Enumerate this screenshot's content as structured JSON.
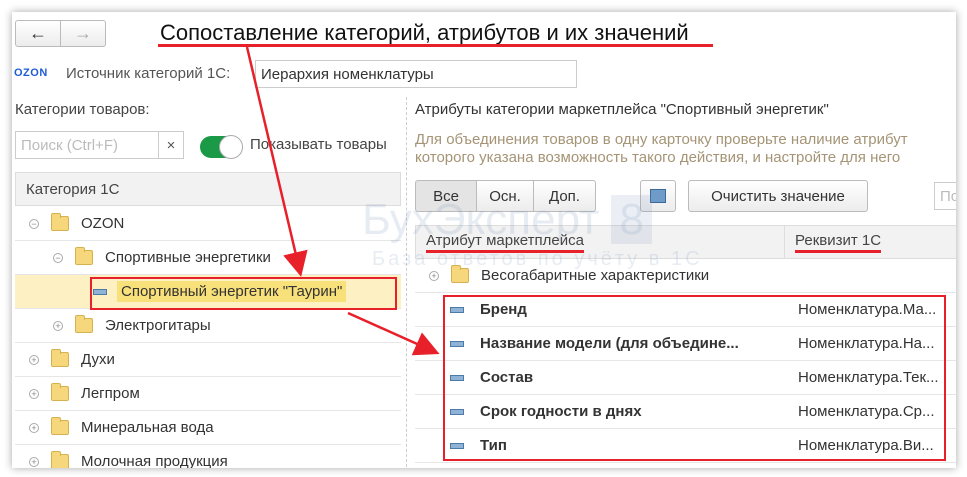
{
  "annotation_title": "Сопоставление категорий, атрибутов и их значений",
  "nav": {
    "back": "←",
    "forward": "→"
  },
  "source": {
    "logo": "OZON",
    "label": "Источник категорий 1С:",
    "value": "Иерархия номенклатуры"
  },
  "left": {
    "title": "Категории товаров:",
    "search_placeholder": "Поиск (Ctrl+F)",
    "clear": "×",
    "toggle_label": "Показывать товары",
    "toggle_on": true,
    "column": "Категория 1С",
    "rows": [
      {
        "label": "OZON",
        "exp": "⊖"
      },
      {
        "label": "Спортивные энергетики",
        "exp": "⊖"
      },
      {
        "label": "Спортивный энергетик \"Таурин\""
      },
      {
        "label": "Электрогитары",
        "exp": "⊕"
      },
      {
        "label": "Духи",
        "exp": "⊕"
      },
      {
        "label": "Легпром",
        "exp": "⊕"
      },
      {
        "label": "Минеральная вода",
        "exp": "⊕"
      },
      {
        "label": "Молочная продукция",
        "exp": "⊕"
      }
    ]
  },
  "right": {
    "title": "Атрибуты категории маркетплейса \"Спортивный энергетик\"",
    "hint1": "Для объединения товаров в одну карточку проверьте наличие атрибут",
    "hint2": "которого указана возможность такого действия, и настройте для него",
    "tabs": [
      "Все",
      "Осн.",
      "Доп."
    ],
    "clear_btn": "Очистить значение",
    "search_placeholder": "По",
    "col1": "Атрибут маркетплейса",
    "col2": "Реквизит 1С",
    "group": "Весогабаритные характеристики",
    "rows": [
      {
        "attr": "Бренд",
        "req": "Номенклатура.Ма..."
      },
      {
        "attr": "Название модели (для объедине...",
        "req": "Номенклатура.На..."
      },
      {
        "attr": "Состав",
        "req": "Номенклатура.Тек..."
      },
      {
        "attr": "Срок годности в днях",
        "req": "Номенклатура.Ср..."
      },
      {
        "attr": "Тип",
        "req": "Номенклатура.Ви..."
      }
    ]
  },
  "watermark": {
    "brand": "БухЭксперт",
    "num": "8",
    "sub": "База ответов по учёту в 1С"
  },
  "colors": {
    "accent_red": "#e8202a",
    "toggle_green": "#1a9a47",
    "selection": "#fdf0c2"
  }
}
